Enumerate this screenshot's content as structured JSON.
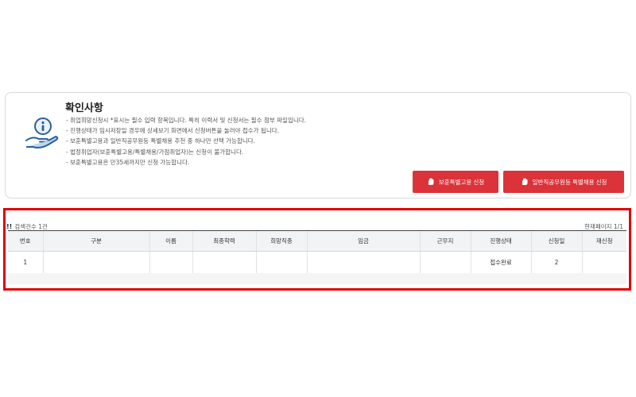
{
  "notice": {
    "title": "확인사항",
    "icon": "info-hand-icon",
    "lines": [
      "- 취업희망신청시 *표시는 필수 입력 항목입니다. 특히 이력서 및 신청서는 필수 첨부 파일입니다.",
      "- 진행상태가 임시저장일 경우에 상세보기 화면에서 신청버튼을 눌러야 접수가 됩니다.",
      "- 보훈특별고용과 일반직공무원등 특별채용 추천 중 하나만 선택 가능합니다.",
      "- 법정취업자(보훈특별고용/특별채용/가점취업자)는 신청이 불가합니다.",
      "- 보훈특별고용은 만35세까지만 신청 가능합니다."
    ],
    "buttons": {
      "special_employment": "보훈특별고용 신청",
      "civil_servant": "일반직공무원등 특별채용 신청"
    }
  },
  "results": {
    "count_label": "검색건수 1건",
    "page_label": "현재페이지 1/1",
    "columns": [
      "번호",
      "구분",
      "이름",
      "최종학력",
      "희망직종",
      "임금",
      "근무지",
      "진행상태",
      "신청일",
      "재신청"
    ],
    "rows": [
      [
        "1",
        "",
        "",
        "",
        "",
        "",
        "",
        "접수완료",
        "2",
        ""
      ]
    ]
  },
  "colors": {
    "accent": "#dc3239",
    "highlight_border": "#e00000"
  }
}
